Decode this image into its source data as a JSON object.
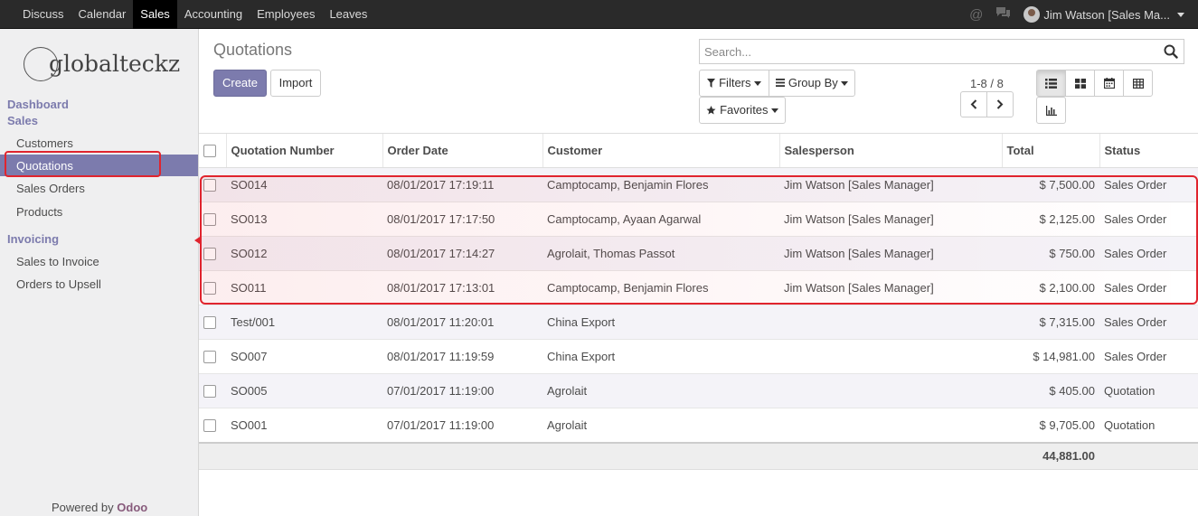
{
  "topbar": {
    "menu": [
      "Discuss",
      "Calendar",
      "Sales",
      "Accounting",
      "Employees",
      "Leaves"
    ],
    "active_menu": "Sales",
    "user_name": "Jim Watson [Sales Ma..."
  },
  "sidebar": {
    "logo_text": "globalteckz",
    "section_dashboard": "Dashboard",
    "section_sales": "Sales",
    "sales_items": [
      "Customers",
      "Quotations",
      "Sales Orders",
      "Products"
    ],
    "active_item": "Quotations",
    "section_invoicing": "Invoicing",
    "invoicing_items": [
      "Sales to Invoice",
      "Orders to Upsell"
    ],
    "powered_by": "Powered by",
    "powered_brand": "Odoo"
  },
  "control_panel": {
    "title": "Quotations",
    "create_label": "Create",
    "import_label": "Import",
    "search_placeholder": "Search...",
    "filters_label": "Filters",
    "group_by_label": "Group By",
    "favorites_label": "Favorites",
    "pager": "1-8 / 8"
  },
  "table": {
    "columns": [
      "Quotation Number",
      "Order Date",
      "Customer",
      "Salesperson",
      "Total",
      "Status"
    ],
    "rows": [
      {
        "number": "SO014",
        "date": "08/01/2017 17:19:11",
        "customer": "Camptocamp, Benjamin Flores",
        "salesperson": "Jim Watson [Sales Manager]",
        "total": "$ 7,500.00",
        "status": "Sales Order"
      },
      {
        "number": "SO013",
        "date": "08/01/2017 17:17:50",
        "customer": "Camptocamp, Ayaan Agarwal",
        "salesperson": "Jim Watson [Sales Manager]",
        "total": "$ 2,125.00",
        "status": "Sales Order"
      },
      {
        "number": "SO012",
        "date": "08/01/2017 17:14:27",
        "customer": "Agrolait, Thomas Passot",
        "salesperson": "Jim Watson [Sales Manager]",
        "total": "$ 750.00",
        "status": "Sales Order"
      },
      {
        "number": "SO011",
        "date": "08/01/2017 17:13:01",
        "customer": "Camptocamp, Benjamin Flores",
        "salesperson": "Jim Watson [Sales Manager]",
        "total": "$ 2,100.00",
        "status": "Sales Order"
      },
      {
        "number": "Test/001",
        "date": "08/01/2017 11:20:01",
        "customer": "China Export",
        "salesperson": "",
        "total": "$ 7,315.00",
        "status": "Sales Order"
      },
      {
        "number": "SO007",
        "date": "08/01/2017 11:19:59",
        "customer": "China Export",
        "salesperson": "",
        "total": "$ 14,981.00",
        "status": "Sales Order"
      },
      {
        "number": "SO005",
        "date": "07/01/2017 11:19:00",
        "customer": "Agrolait",
        "salesperson": "",
        "total": "$ 405.00",
        "status": "Quotation"
      },
      {
        "number": "SO001",
        "date": "07/01/2017 11:19:00",
        "customer": "Agrolait",
        "salesperson": "",
        "total": "$ 9,705.00",
        "status": "Quotation"
      }
    ],
    "footer_total": "44,881.00"
  },
  "colors": {
    "brand": "#7c7bad",
    "highlight": "#e0242e",
    "topbar": "#2a2a2a"
  }
}
